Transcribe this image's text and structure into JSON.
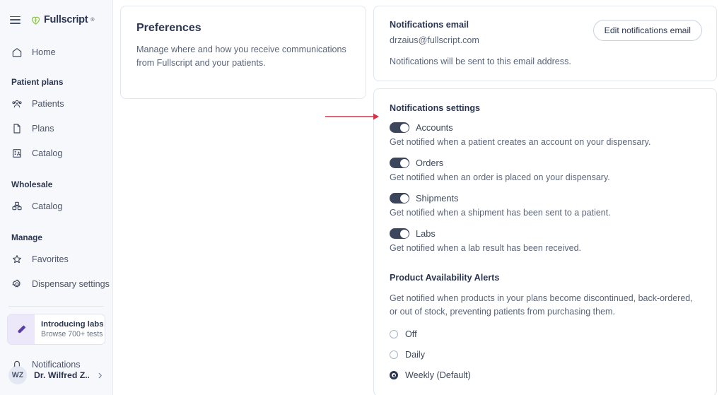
{
  "sidebar": {
    "menu_icon": "hamburger-icon",
    "logo": {
      "mark": "fullscript-heart-icon",
      "text": "Fullscript",
      "tm": "®"
    },
    "home": {
      "label": "Home",
      "icon": "home-icon"
    },
    "sections": [
      {
        "title": "Patient plans",
        "items": [
          {
            "label": "Patients",
            "icon": "people-group-icon"
          },
          {
            "label": "Plans",
            "icon": "document-icon"
          },
          {
            "label": "Catalog",
            "icon": "catalog-person-icon"
          }
        ]
      },
      {
        "title": "Wholesale",
        "items": [
          {
            "label": "Catalog",
            "icon": "boxes-icon"
          }
        ]
      },
      {
        "title": "Manage",
        "items": [
          {
            "label": "Favorites",
            "icon": "star-icon"
          },
          {
            "label": "Dispensary settings",
            "icon": "gear-icon"
          }
        ]
      }
    ],
    "promo": {
      "title": "Introducing labs",
      "subtitle": "Browse 700+ tests",
      "icon": "test-tube-icon"
    },
    "notifications": {
      "label": "Notifications",
      "icon": "bell-icon"
    },
    "user": {
      "initials": "WZ",
      "name": "Dr. Wilfred Z...",
      "chevron": "chevron-right-icon"
    }
  },
  "preferences": {
    "title": "Preferences",
    "description": "Manage where and how you receive communications from Fullscript and your patients."
  },
  "notifications_email": {
    "title": "Notifications email",
    "address": "drzaius@fullscript.com",
    "note": "Notifications will be sent to this email address.",
    "edit_button": "Edit notifications email"
  },
  "notifications_settings": {
    "title": "Notifications settings",
    "toggles": [
      {
        "label": "Accounts",
        "description": "Get notified when a patient creates an account on your dispensary.",
        "state": "on"
      },
      {
        "label": "Orders",
        "description": "Get notified when an order is placed on your dispensary.",
        "state": "on"
      },
      {
        "label": "Shipments",
        "description": "Get notified when a shipment has been sent to a patient.",
        "state": "on"
      },
      {
        "label": "Labs",
        "description": "Get notified when a lab result has been received.",
        "state": "on"
      }
    ]
  },
  "product_availability": {
    "title": "Product Availability Alerts",
    "description": "Get notified when products in your plans become discontinued, back-ordered, or out of stock, preventing patients from purchasing them.",
    "options": [
      {
        "label": "Off",
        "selected": false
      },
      {
        "label": "Daily",
        "selected": false
      },
      {
        "label": "Weekly (Default)",
        "selected": true
      }
    ]
  },
  "annotation": {
    "arrow_color": "#d3344a",
    "points_to": "Notifications settings"
  },
  "colors": {
    "sidebar_bg": "#f7f8fb",
    "text_dark": "#2c3650",
    "text_muted": "#5a6478",
    "border": "#e1e6ef",
    "toggle_on": "#3b455c",
    "promo_accent": "#ece8f9",
    "logo_green": "#8bc34a"
  }
}
